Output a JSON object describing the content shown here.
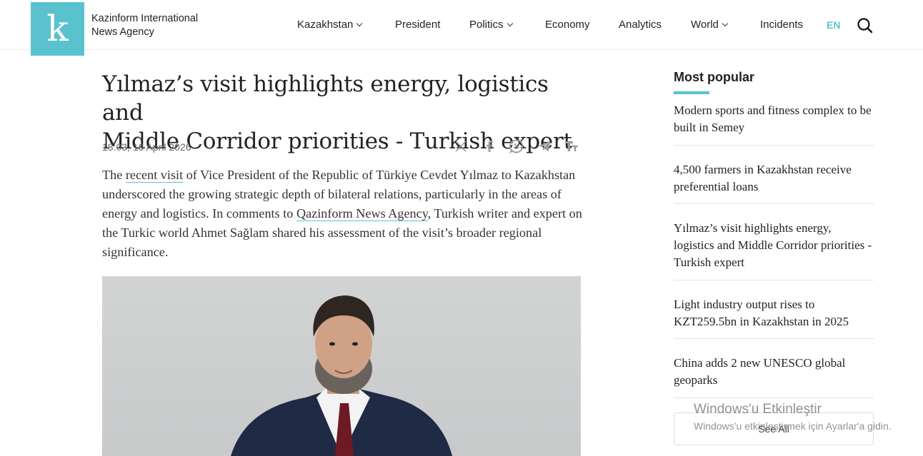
{
  "header": {
    "logo_letter": "k",
    "brand_line1": "Kazinform International",
    "brand_line2": "News Agency",
    "nav": [
      {
        "label": "Kazakhstan",
        "dropdown": true
      },
      {
        "label": "President",
        "dropdown": false
      },
      {
        "label": "Politics",
        "dropdown": true
      },
      {
        "label": "Economy",
        "dropdown": false
      },
      {
        "label": "Analytics",
        "dropdown": false
      },
      {
        "label": "World",
        "dropdown": true
      },
      {
        "label": "Incidents",
        "dropdown": false
      }
    ],
    "language": "EN"
  },
  "article": {
    "title_line1": "Yılmaz’s visit highlights energy, logistics and",
    "title_line2": "Middle Corridor priorities - Turkish expert",
    "date": "18:03, 16 April 2026",
    "share_icons": [
      "x-icon",
      "facebook-icon",
      "whatsapp-icon",
      "telegram-icon",
      "text-size-icon"
    ],
    "para_1": "The ",
    "link_1": "recent visit",
    "para_2": " of Vice President of the Republic of Türkiye Cevdet Yılmaz to Kazakhstan underscored the growing strategic depth of bilateral relations, particularly in the areas of energy and logistics. In comments to ",
    "link_2": "Qazinform News Agency",
    "para_3": ", Turkish writer and expert on the Turkic world Ahmet Sağlam shared his assessment of the visit’s broader regional significance."
  },
  "sidebar": {
    "title": "Most popular",
    "items": [
      "Modern sports and fitness complex to be built in Semey",
      "4,500 farmers in Kazakhstan receive preferential loans",
      "Yılmaz’s visit highlights energy, logistics and Middle Corridor priorities - Turkish expert",
      "Light industry output rises to KZT259.5bn in Kazakhstan in 2025",
      "China adds 2 new UNESCO global geoparks"
    ],
    "see_all": "See All"
  },
  "watermark": {
    "title": "Windows'u Etkinleştir",
    "subtitle": "Windows'u etkinleştirmek için Ayarlar'a gidin."
  },
  "colors": {
    "accent": "#5ac2cf",
    "text": "#222222"
  }
}
